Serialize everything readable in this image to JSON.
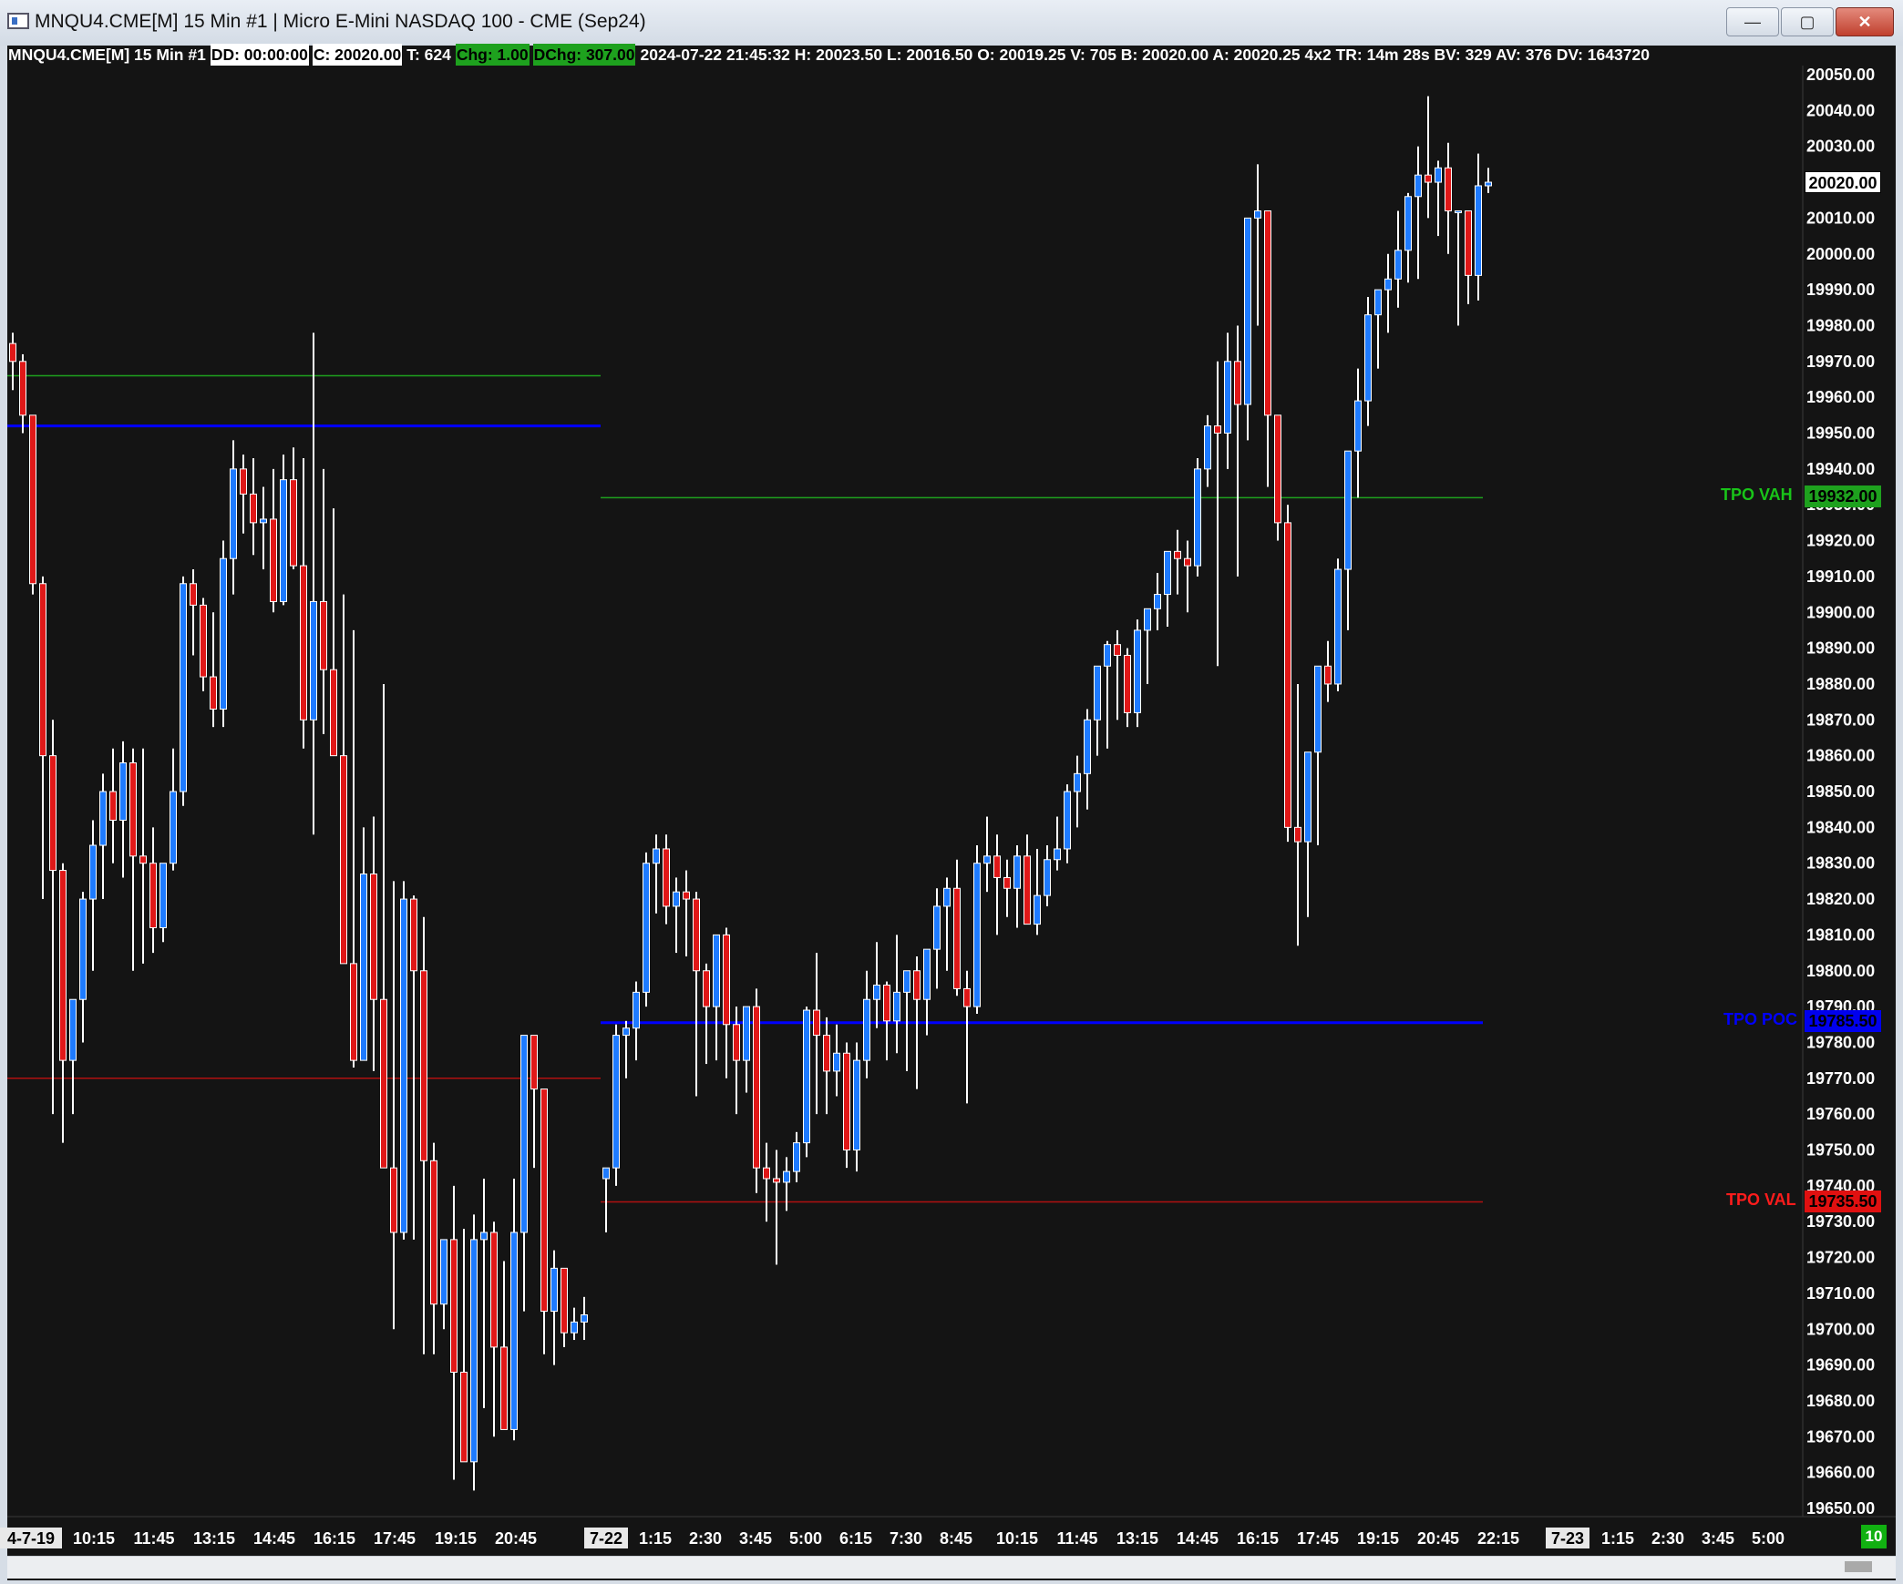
{
  "window": {
    "title": "MNQU4.CME[M]  15 Min  #1 | Micro E-Mini NASDAQ 100 - CME (Sep24)",
    "buttons": {
      "minimize": "—",
      "maximize": "▢",
      "close": "✕"
    }
  },
  "infobar": {
    "symbol": "MNQU4.CME[M]  15 Min  #1",
    "dd": "DD: 00:00:00",
    "close": "C: 20020.00",
    "ticks": "T: 624",
    "chg": "Chg: 1.00",
    "dchg": "DChg: 307.00",
    "stats": "2024-07-22 21:45:32 H: 20023.50 L: 20016.50 O: 20019.25 V: 705 B: 20020.00 A: 20020.25 4x2 TR: 14m 28s BV: 329 AV: 376 DV: 1643720"
  },
  "tpo": {
    "vah_label": "TPO VAH",
    "vah_price": "19932.00",
    "poc_label": "TPO POC",
    "poc_price": "19785.50",
    "val_label": "TPO VAL",
    "val_price": "19735.50"
  },
  "current_price": "20020.00",
  "bars_count": "10",
  "colors": {
    "up": "#1e7bff",
    "down": "#e01818",
    "wick": "#ffffff",
    "background": "#141414",
    "vah": "#1ea11e",
    "poc": "#0000ff",
    "val": "#b01010"
  },
  "chart_data": {
    "type": "candlestick",
    "ylim": [
      19645,
      20055
    ],
    "y_ticks": [
      "20050.00",
      "20040.00",
      "20030.00",
      "20020.00",
      "20010.00",
      "20000.00",
      "19990.00",
      "19980.00",
      "19970.00",
      "19960.00",
      "19950.00",
      "19940.00",
      "19930.00",
      "19920.00",
      "19910.00",
      "19900.00",
      "19890.00",
      "19880.00",
      "19870.00",
      "19860.00",
      "19850.00",
      "19840.00",
      "19830.00",
      "19820.00",
      "19810.00",
      "19800.00",
      "19790.00",
      "19780.00",
      "19770.00",
      "19760.00",
      "19750.00",
      "19740.00",
      "19730.00",
      "19720.00",
      "19710.00",
      "19700.00",
      "19690.00",
      "19680.00",
      "19670.00",
      "19660.00",
      "19650.00"
    ],
    "x_ticks": [
      {
        "label": "4-7-19",
        "boxed": true
      },
      {
        "label": "10:15"
      },
      {
        "label": "11:45"
      },
      {
        "label": "13:15"
      },
      {
        "label": "14:45"
      },
      {
        "label": "16:15"
      },
      {
        "label": "17:45"
      },
      {
        "label": "19:15"
      },
      {
        "label": "20:45"
      },
      {
        "label": "7-22",
        "boxed": true
      },
      {
        "label": "1:15"
      },
      {
        "label": "2:30"
      },
      {
        "label": "3:45"
      },
      {
        "label": "5:00"
      },
      {
        "label": "6:15"
      },
      {
        "label": "7:30"
      },
      {
        "label": "8:45"
      },
      {
        "label": "10:15"
      },
      {
        "label": "11:45"
      },
      {
        "label": "13:15"
      },
      {
        "label": "14:45"
      },
      {
        "label": "16:15"
      },
      {
        "label": "17:45"
      },
      {
        "label": "19:15"
      },
      {
        "label": "20:45"
      },
      {
        "label": "22:15"
      },
      {
        "label": "7-23",
        "boxed": true
      },
      {
        "label": "1:15"
      },
      {
        "label": "2:30"
      },
      {
        "label": "3:45"
      },
      {
        "label": "5:00"
      }
    ],
    "prior_session_levels": {
      "vah": 19966,
      "poc": 19952,
      "val": 19770
    },
    "session1_candles": [
      [
        19975,
        19978,
        19962,
        19970
      ],
      [
        19970,
        19972,
        19950,
        19955
      ],
      [
        19955,
        19955,
        19905,
        19908
      ],
      [
        19908,
        19910,
        19820,
        19860
      ],
      [
        19860,
        19870,
        19760,
        19828
      ],
      [
        19828,
        19830,
        19752,
        19775
      ],
      [
        19775,
        19790,
        19760,
        19792
      ],
      [
        19792,
        19822,
        19780,
        19820
      ],
      [
        19820,
        19842,
        19800,
        19835
      ],
      [
        19835,
        19855,
        19820,
        19850
      ],
      [
        19850,
        19862,
        19830,
        19842
      ],
      [
        19842,
        19864,
        19826,
        19858
      ],
      [
        19858,
        19862,
        19800,
        19832
      ],
      [
        19832,
        19862,
        19802,
        19830
      ],
      [
        19830,
        19840,
        19805,
        19812
      ],
      [
        19812,
        19830,
        19808,
        19830
      ],
      [
        19830,
        19862,
        19828,
        19850
      ],
      [
        19850,
        19910,
        19846,
        19908
      ],
      [
        19908,
        19912,
        19888,
        19902
      ],
      [
        19902,
        19904,
        19878,
        19882
      ],
      [
        19882,
        19900,
        19868,
        19873
      ],
      [
        19873,
        19920,
        19868,
        19915
      ],
      [
        19915,
        19948,
        19905,
        19940
      ],
      [
        19940,
        19944,
        19922,
        19933
      ],
      [
        19933,
        19943,
        19916,
        19925
      ],
      [
        19925,
        19935,
        19912,
        19926
      ],
      [
        19926,
        19940,
        19900,
        19903
      ],
      [
        19903,
        19944,
        19902,
        19937
      ],
      [
        19937,
        19946,
        19912,
        19913
      ],
      [
        19913,
        19943,
        19862,
        19870
      ],
      [
        19870,
        19978,
        19838,
        19903
      ],
      [
        19903,
        19940,
        19866,
        19884
      ],
      [
        19884,
        19929,
        19864,
        19860
      ],
      [
        19860,
        19905,
        19849,
        19802
      ],
      [
        19802,
        19895,
        19773,
        19775
      ],
      [
        19775,
        19840,
        19775,
        19827
      ],
      [
        19827,
        19843,
        19772,
        19792
      ],
      [
        19792,
        19880,
        19762,
        19745
      ],
      [
        19745,
        19825,
        19700,
        19727
      ],
      [
        19727,
        19825,
        19725,
        19820
      ],
      [
        19820,
        19821,
        19725,
        19800
      ],
      [
        19800,
        19815,
        19693,
        19747
      ],
      [
        19747,
        19752,
        19693,
        19707
      ],
      [
        19707,
        19725,
        19700,
        19725
      ],
      [
        19725,
        19740,
        19658,
        19688
      ],
      [
        19688,
        19728,
        19672,
        19663
      ],
      [
        19663,
        19732,
        19655,
        19725
      ],
      [
        19725,
        19742,
        19678,
        19727
      ],
      [
        19727,
        19730,
        19670,
        19695
      ],
      [
        19695,
        19719,
        19680,
        19672
      ],
      [
        19672,
        19742,
        19669,
        19727
      ],
      [
        19727,
        19770,
        19705,
        19782
      ],
      [
        19782,
        19770,
        19745,
        19767
      ],
      [
        19767,
        19755,
        19693,
        19705
      ],
      [
        19705,
        19722,
        19690,
        19717
      ],
      [
        19717,
        19715,
        19695,
        19699
      ],
      [
        19699,
        19706,
        19697,
        19702
      ],
      [
        19702,
        19709,
        19697,
        19704
      ]
    ],
    "session2_candles": [
      [
        19742,
        19745,
        19727,
        19745
      ],
      [
        19745,
        19785,
        19740,
        19782
      ],
      [
        19782,
        19786,
        19770,
        19784
      ],
      [
        19784,
        19797,
        19775,
        19794
      ],
      [
        19794,
        19833,
        19790,
        19830
      ],
      [
        19830,
        19838,
        19816,
        19834
      ],
      [
        19834,
        19838,
        19813,
        19818
      ],
      [
        19818,
        19826,
        19805,
        19822
      ],
      [
        19822,
        19828,
        19804,
        19820
      ],
      [
        19820,
        19822,
        19765,
        19800
      ],
      [
        19800,
        19802,
        19774,
        19790
      ],
      [
        19790,
        19810,
        19775,
        19810
      ],
      [
        19810,
        19812,
        19770,
        19785
      ],
      [
        19785,
        19790,
        19760,
        19775
      ],
      [
        19775,
        19788,
        19766,
        19790
      ],
      [
        19790,
        19795,
        19738,
        19745
      ],
      [
        19745,
        19752,
        19730,
        19742
      ],
      [
        19742,
        19750,
        19718,
        19741
      ],
      [
        19741,
        19748,
        19733,
        19744
      ],
      [
        19744,
        19755,
        19741,
        19752
      ],
      [
        19752,
        19790,
        19748,
        19789
      ],
      [
        19789,
        19805,
        19760,
        19782
      ],
      [
        19782,
        19787,
        19760,
        19772
      ],
      [
        19772,
        19785,
        19765,
        19777
      ],
      [
        19777,
        19780,
        19745,
        19750
      ],
      [
        19750,
        19780,
        19744,
        19775
      ],
      [
        19775,
        19800,
        19770,
        19792
      ],
      [
        19792,
        19808,
        19784,
        19796
      ],
      [
        19796,
        19797,
        19775,
        19786
      ],
      [
        19786,
        19810,
        19777,
        19794
      ],
      [
        19794,
        19800,
        19772,
        19800
      ],
      [
        19800,
        19804,
        19767,
        19792
      ],
      [
        19792,
        19805,
        19782,
        19806
      ],
      [
        19806,
        19823,
        19795,
        19818
      ],
      [
        19818,
        19826,
        19800,
        19823
      ],
      [
        19823,
        19831,
        19793,
        19795
      ],
      [
        19795,
        19800,
        19763,
        19790
      ],
      [
        19790,
        19835,
        19788,
        19830
      ],
      [
        19830,
        19843,
        19822,
        19832
      ],
      [
        19832,
        19838,
        19810,
        19826
      ],
      [
        19826,
        19831,
        19815,
        19823
      ],
      [
        19823,
        19835,
        19812,
        19832
      ],
      [
        19832,
        19838,
        19816,
        19813
      ],
      [
        19813,
        19834,
        19810,
        19821
      ],
      [
        19821,
        19835,
        19818,
        19831
      ],
      [
        19831,
        19843,
        19828,
        19834
      ],
      [
        19834,
        19852,
        19830,
        19850
      ],
      [
        19850,
        19860,
        19840,
        19855
      ],
      [
        19855,
        19873,
        19845,
        19870
      ],
      [
        19870,
        19885,
        19860,
        19885
      ],
      [
        19885,
        19892,
        19862,
        19891
      ],
      [
        19891,
        19895,
        19870,
        19888
      ],
      [
        19888,
        19890,
        19868,
        19872
      ],
      [
        19872,
        19898,
        19868,
        19895
      ],
      [
        19895,
        19900,
        19880,
        19901
      ],
      [
        19901,
        19911,
        19895,
        19905
      ],
      [
        19905,
        19912,
        19896,
        19917
      ],
      [
        19917,
        19923,
        19905,
        19915
      ],
      [
        19915,
        19920,
        19900,
        19913
      ],
      [
        19913,
        19943,
        19910,
        19940
      ],
      [
        19940,
        19955,
        19935,
        19952
      ],
      [
        19952,
        19970,
        19885,
        19950
      ],
      [
        19950,
        19978,
        19940,
        19970
      ],
      [
        19970,
        19980,
        19910,
        19958
      ],
      [
        19958,
        20002,
        19948,
        20010
      ],
      [
        20010,
        20025,
        19980,
        20012
      ],
      [
        20012,
        19995,
        19935,
        19955
      ],
      [
        19955,
        19955,
        19920,
        19925
      ],
      [
        19925,
        19930,
        19836,
        19840
      ],
      [
        19840,
        19880,
        19807,
        19836
      ],
      [
        19836,
        19860,
        19815,
        19861
      ],
      [
        19861,
        19880,
        19835,
        19885
      ],
      [
        19885,
        19892,
        19875,
        19880
      ],
      [
        19880,
        19915,
        19878,
        19912
      ],
      [
        19912,
        19930,
        19895,
        19945
      ],
      [
        19945,
        19968,
        19932,
        19959
      ],
      [
        19959,
        19988,
        19952,
        19983
      ],
      [
        19983,
        19990,
        19968,
        19990
      ],
      [
        19990,
        20000,
        19978,
        19993
      ],
      [
        19993,
        20012,
        19985,
        20001
      ],
      [
        20001,
        20017,
        19992,
        20016
      ],
      [
        20016,
        20030,
        19993,
        20022
      ],
      [
        20022,
        20044,
        20010,
        20020
      ],
      [
        20020,
        20026,
        20005,
        20024
      ],
      [
        20024,
        20031,
        20000,
        20012
      ],
      [
        20012,
        20012,
        19980,
        20012
      ],
      [
        20012,
        20002,
        19986,
        19994
      ],
      [
        19994,
        20028,
        19987,
        20019
      ],
      [
        20019,
        20024,
        20017,
        20020
      ]
    ]
  }
}
